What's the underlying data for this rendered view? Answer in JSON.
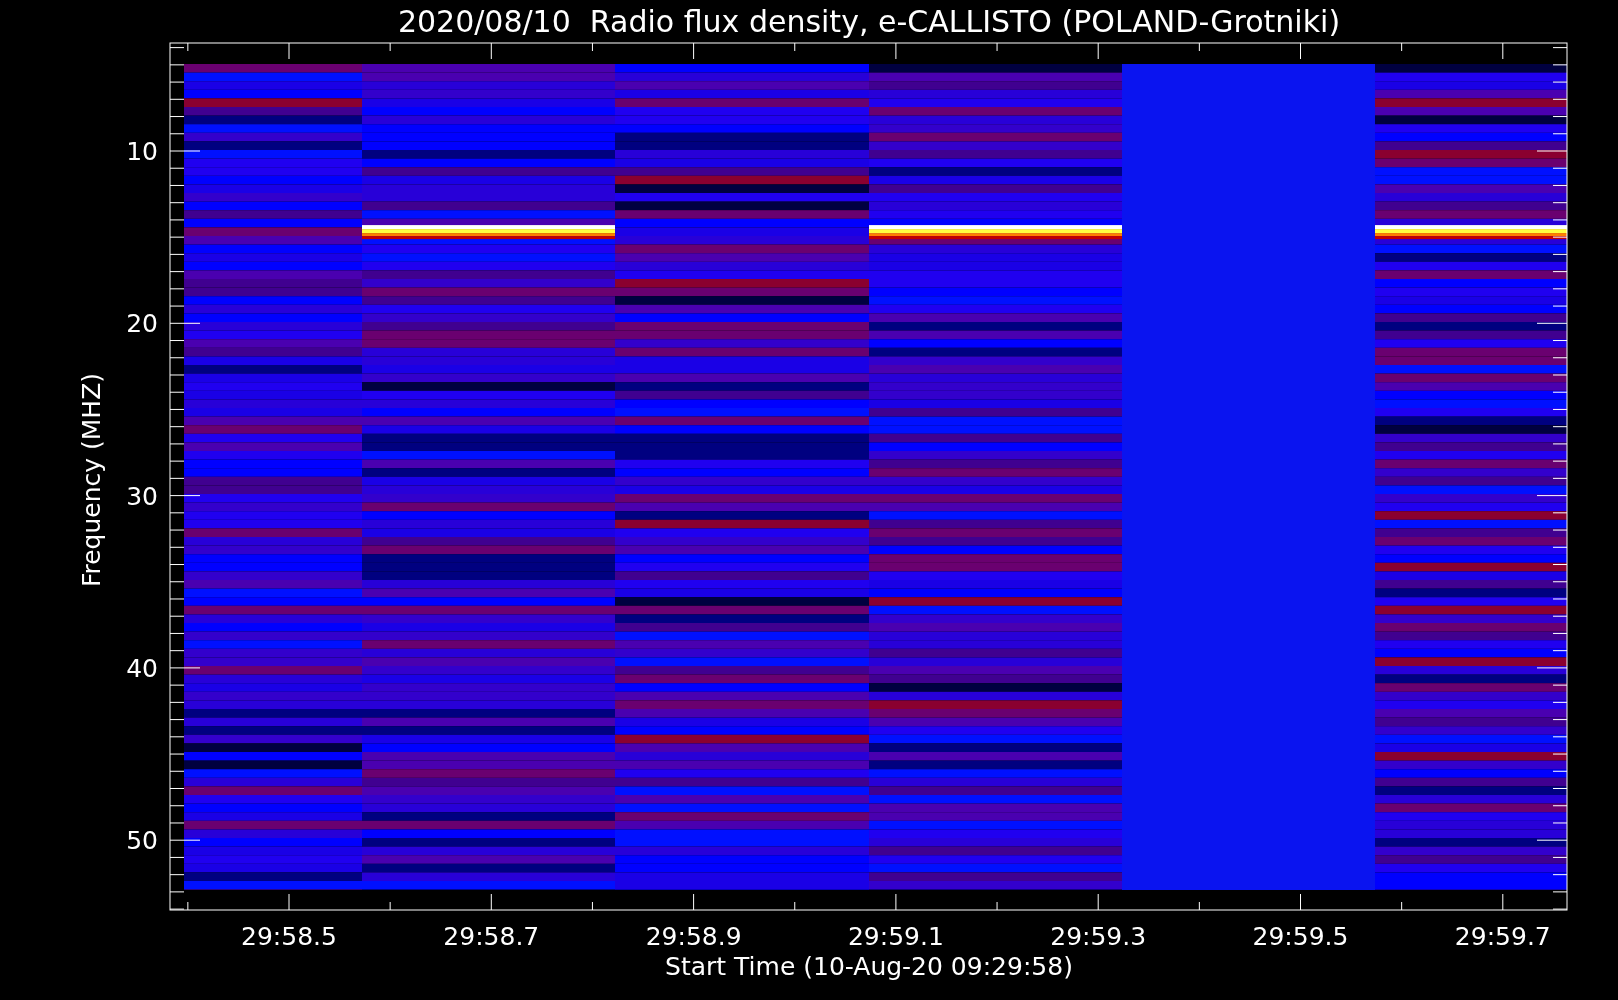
{
  "title": "2020/08/10  Radio flux density, e-CALLISTO (POLAND-Grotniki)",
  "x_axis": {
    "label": "Start Time (10-Aug-20 09:29:58)",
    "ticks": [
      "29:58.5",
      "29:58.7",
      "29:58.9",
      "29:59.1",
      "29:59.3",
      "29:59.5",
      "29:59.7"
    ]
  },
  "y_axis": {
    "label": "Frequency (MHZ)",
    "ticks": [
      "10",
      "20",
      "30",
      "40",
      "50"
    ]
  },
  "columns": [
    {
      "kind": "bands",
      "burst": false
    },
    {
      "kind": "bands",
      "burst": true
    },
    {
      "kind": "bands",
      "burst": false
    },
    {
      "kind": "bands",
      "burst": true
    },
    {
      "kind": "flat",
      "burst": false
    },
    {
      "kind": "bands",
      "burst": true
    }
  ]
}
